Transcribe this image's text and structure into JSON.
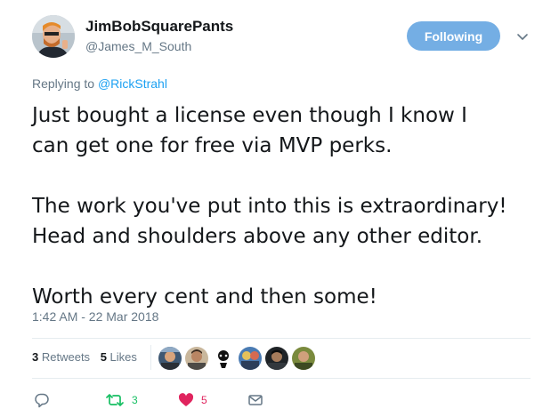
{
  "author": {
    "display_name": "JimBobSquarePants",
    "handle": "@James_M_South",
    "avatar_icon": "profile-photo"
  },
  "follow_button": {
    "label": "Following",
    "color": "#74aee4"
  },
  "reply_context": {
    "prefix": "Replying to",
    "mention": "@RickStrahl"
  },
  "tweet": {
    "paragraphs": [
      "Just bought a license even though I know I",
      "can get one for free via MVP perks.",
      "The work you've put into this is extraordinary!",
      "Head and shoulders above any other editor.",
      "Worth every cent and then some!"
    ],
    "timestamp": "1:42 AM - 22 Mar 2018"
  },
  "stats": {
    "retweets_count": "3",
    "retweets_label": "Retweets",
    "likes_count": "5",
    "likes_label": "Likes"
  },
  "actions": {
    "reply_count": "",
    "retweet_count": "3",
    "like_count": "5",
    "retweet_color": "#17bf63",
    "like_color": "#e0245e"
  },
  "colors": {
    "link": "#1da1f2",
    "secondary_text": "#657786",
    "primary_text": "#14171a"
  }
}
